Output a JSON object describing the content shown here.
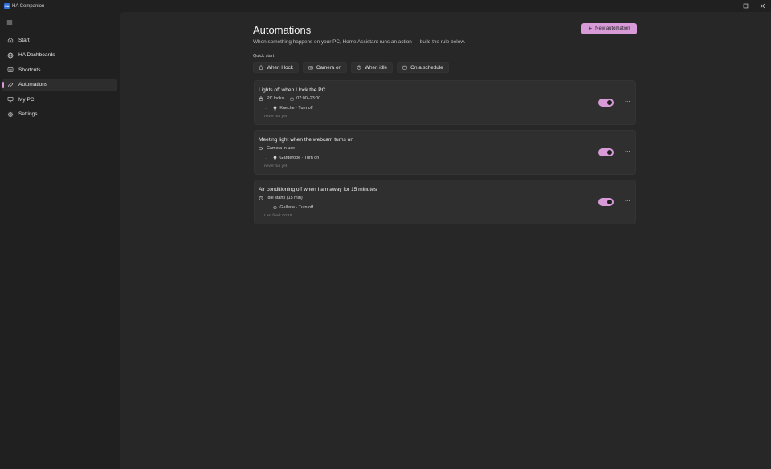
{
  "window": {
    "app_icon_text": "HA",
    "title": "HA Companion"
  },
  "sidebar": {
    "items": [
      {
        "label": "Start",
        "icon": "home-icon"
      },
      {
        "label": "HA Dashboards",
        "icon": "globe-icon"
      },
      {
        "label": "Shortcuts",
        "icon": "shortcuts-icon"
      },
      {
        "label": "Automations",
        "icon": "automation-icon",
        "active": true
      },
      {
        "label": "My PC",
        "icon": "monitor-icon"
      },
      {
        "label": "Settings",
        "icon": "gear-icon"
      }
    ]
  },
  "page": {
    "title": "Automations",
    "subtitle": "When something happens on your PC, Home Assistant runs an action — build the rule below.",
    "new_button": "New automation",
    "quick_start_label": "Quick start",
    "quick_start": [
      {
        "label": "When I lock",
        "icon": "lock-icon"
      },
      {
        "label": "Camera on",
        "icon": "camera-icon"
      },
      {
        "label": "When idle",
        "icon": "timer-icon"
      },
      {
        "label": "On a schedule",
        "icon": "calendar-icon"
      }
    ]
  },
  "automations": [
    {
      "title": "Lights off when I lock the PC",
      "trigger": "PC locks",
      "trigger_icon": "lock-icon",
      "schedule": "07:00–23:00",
      "action": "Kueche · Turn off",
      "action_icon": "bulb-icon",
      "footer": "never run yet",
      "enabled": true
    },
    {
      "title": "Meeting light when the webcam turns on",
      "trigger": "Camera in use",
      "trigger_icon": "camera-icon",
      "schedule": "",
      "action": "Garderobe · Turn on",
      "action_icon": "bulb-icon",
      "footer": "never run yet",
      "enabled": true
    },
    {
      "title": "Air conditioning off when I am away for 15 minutes",
      "trigger": "Idle starts (15 min)",
      "trigger_icon": "timer-icon",
      "schedule": "",
      "action": "Gallerie · Turn off",
      "action_icon": "fan-icon",
      "footer": "Last fired: 00:15",
      "enabled": true
    }
  ],
  "colors": {
    "accent": "#d89bd8",
    "background": "#202020",
    "content": "#272727",
    "card": "#2f2f2f"
  }
}
